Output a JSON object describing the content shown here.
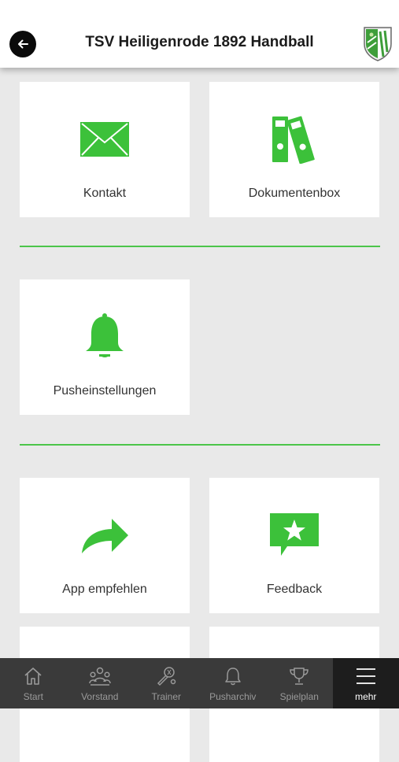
{
  "header": {
    "title": "TSV Heiligenrode 1892 Handball",
    "back_icon": "arrow-left-icon",
    "logo": "club-crest-logo"
  },
  "colors": {
    "accent": "#3cc13a",
    "tile_bg": "#ffffff",
    "page_bg": "#e9e9e9",
    "tabbar_bg": "#3a3a3a",
    "tabbar_active_bg": "#1d1d1d"
  },
  "tiles": [
    {
      "label": "Kontakt",
      "icon": "envelope-icon"
    },
    {
      "label": "Dokumentenbox",
      "icon": "binders-icon"
    },
    {
      "label": "Pusheinstellungen",
      "icon": "bell-icon"
    },
    {
      "label": "App empfehlen",
      "icon": "share-arrow-icon"
    },
    {
      "label": "Feedback",
      "icon": "star-speech-bubble-icon"
    }
  ],
  "tabbar": {
    "items": [
      {
        "label": "Start",
        "icon": "home-icon"
      },
      {
        "label": "Vorstand",
        "icon": "group-icon"
      },
      {
        "label": "Trainer",
        "icon": "whistle-icon"
      },
      {
        "label": "Pusharchiv",
        "icon": "bell-outline-icon"
      },
      {
        "label": "Spielplan",
        "icon": "trophy-icon"
      },
      {
        "label": "mehr",
        "icon": "menu-icon",
        "active": true
      }
    ]
  }
}
